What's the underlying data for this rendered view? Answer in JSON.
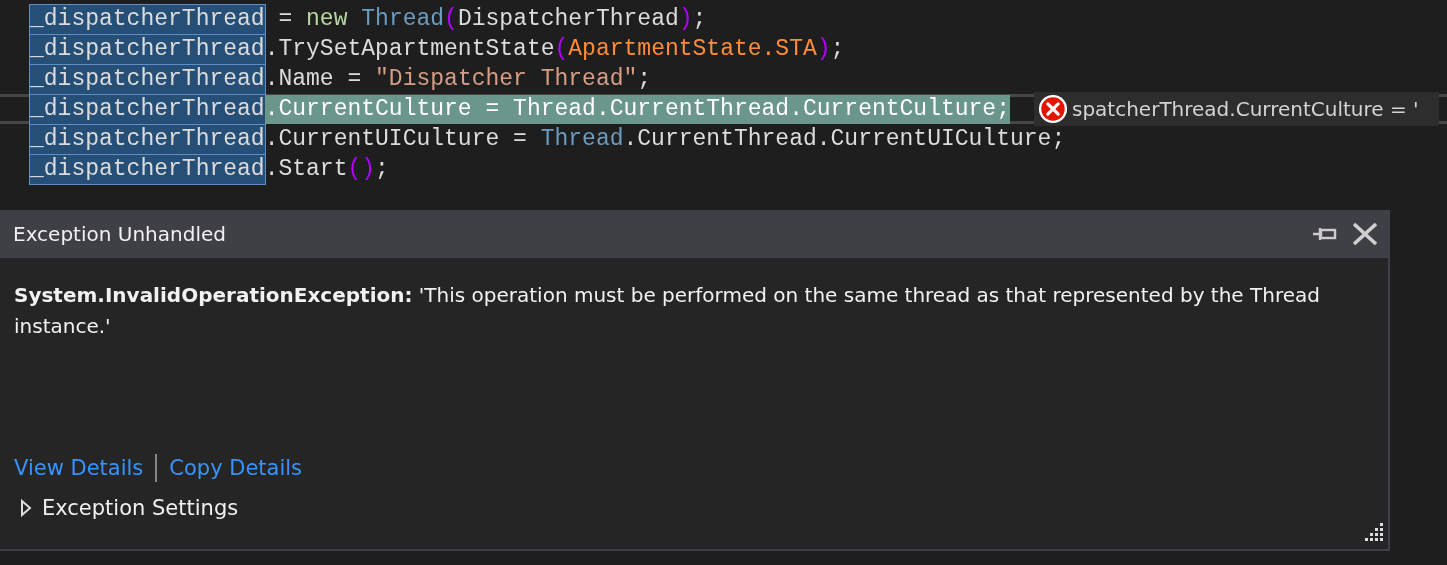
{
  "code_lines": [
    {
      "current": false,
      "tokens": [
        {
          "text": "_dispatcherThread",
          "kind": "selection"
        },
        {
          "text": " = ",
          "kind": "plain"
        },
        {
          "text": "new ",
          "kind": "keyword"
        },
        {
          "text": "Thread",
          "kind": "type"
        },
        {
          "text": "(",
          "kind": "paren"
        },
        {
          "text": "DispatcherThread",
          "kind": "plain"
        },
        {
          "text": ")",
          "kind": "paren"
        },
        {
          "text": ";",
          "kind": "plain"
        }
      ]
    },
    {
      "current": false,
      "tokens": [
        {
          "text": "_dispatcherThread",
          "kind": "selection"
        },
        {
          "text": ".TrySetApartmentState",
          "kind": "plain"
        },
        {
          "text": "(",
          "kind": "paren"
        },
        {
          "text": "ApartmentState.STA",
          "kind": "enum"
        },
        {
          "text": ")",
          "kind": "paren"
        },
        {
          "text": ";",
          "kind": "plain"
        }
      ]
    },
    {
      "current": false,
      "tokens": [
        {
          "text": "_dispatcherThread",
          "kind": "selection"
        },
        {
          "text": ".Name = ",
          "kind": "plain"
        },
        {
          "text": "\"Dispatcher Thread\"",
          "kind": "string"
        },
        {
          "text": ";",
          "kind": "plain"
        }
      ]
    },
    {
      "current": true,
      "tokens": [
        {
          "text": "_dispatcherThread",
          "kind": "selection"
        },
        {
          "text": ".CurrentCulture = Thread.CurrentThread.CurrentCulture;",
          "kind": "plain"
        }
      ],
      "inline_error": "spatcherThread.CurrentCulture = '"
    },
    {
      "current": false,
      "tokens": [
        {
          "text": "_dispatcherThread",
          "kind": "selection"
        },
        {
          "text": ".CurrentUICulture = ",
          "kind": "plain"
        },
        {
          "text": "Thread",
          "kind": "type"
        },
        {
          "text": ".CurrentThread.CurrentUICulture;",
          "kind": "plain"
        }
      ]
    },
    {
      "current": false,
      "tokens": [
        {
          "text": "_dispatcherThread",
          "kind": "selection"
        },
        {
          "text": ".Start",
          "kind": "plain"
        },
        {
          "text": "()",
          "kind": "paren"
        },
        {
          "text": ";",
          "kind": "plain"
        }
      ]
    }
  ],
  "dialog": {
    "title": "Exception Unhandled",
    "message": "**System.InvalidOperationException:** 'This operation must be performed on the same thread as that represented by the Thread instance.'",
    "links": [
      "View Details",
      "Copy Details"
    ],
    "settings": {
      "label": "Exception Settings",
      "expanded": false
    }
  }
}
